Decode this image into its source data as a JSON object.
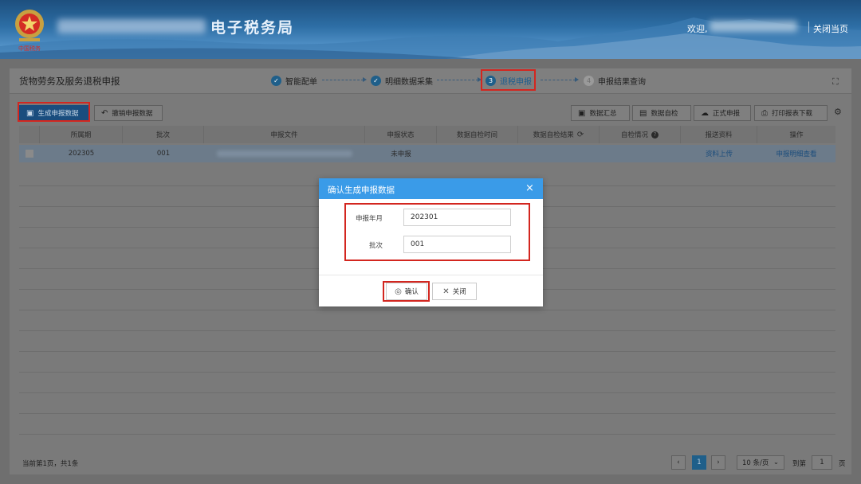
{
  "header": {
    "site_title": "电子税务局",
    "welcome": "欢迎,",
    "close_page": "关闭当页"
  },
  "page": {
    "title": "货物劳务及服务退税申报",
    "steps": [
      {
        "label": "智能配单",
        "state": "done"
      },
      {
        "label": "明细数据采集",
        "state": "done"
      },
      {
        "label": "退税申报",
        "num": "3",
        "state": "active"
      },
      {
        "label": "申报结果查询",
        "num": "4",
        "state": "pending"
      }
    ]
  },
  "toolbar": {
    "generate": "生成申报数据",
    "revoke": "撤销申报数据",
    "summary": "数据汇总",
    "self_check": "数据自检",
    "formal_declare": "正式申报",
    "print_download": "打印报表下载"
  },
  "table": {
    "headers": [
      "所属期",
      "批次",
      "申报文件",
      "申报状态",
      "数据自检时间",
      "数据自检结果",
      "自检情况",
      "报送资料",
      "操作"
    ],
    "rows": [
      {
        "period": "202305",
        "batch": "001",
        "status": "未申报",
        "upload": "资料上传",
        "action": "申报明细查看"
      }
    ]
  },
  "footer": {
    "info": "当前第1页，共1条",
    "current_page": "1",
    "page_size": "10 条/页",
    "goto_label": "到第",
    "goto_value": "1",
    "page_unit": "页"
  },
  "modal": {
    "title": "确认生成申报数据",
    "period_label": "申报年月",
    "period_value": "202301",
    "batch_label": "批次",
    "batch_value": "001",
    "confirm": "确认",
    "close": "关闭"
  },
  "colors": {
    "modal_header": "#3a9be8",
    "highlight": "#d3261f",
    "primary": "#1a4d7e"
  }
}
